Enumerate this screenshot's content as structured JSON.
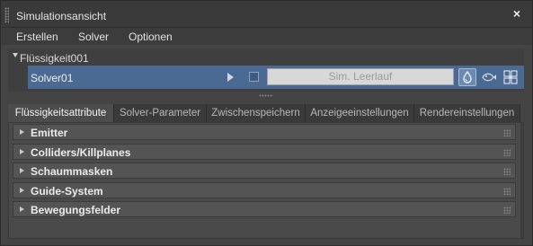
{
  "window": {
    "title": "Simulationsansicht",
    "close_icon": "×"
  },
  "menu": {
    "items": [
      "Erstellen",
      "Solver",
      "Optionen"
    ]
  },
  "tree": {
    "parent_label": "Flüssigkeit001",
    "child_label": "Solver01",
    "sim_status": "Sim. Leerlauf",
    "icons": [
      "play-icon",
      "stop-icon",
      "fluid-drop-icon",
      "fish-icon",
      "grid-icon"
    ]
  },
  "tabs": [
    {
      "label": "Flüssigkeitsattribute",
      "active": true
    },
    {
      "label": "Solver-Parameter",
      "active": false
    },
    {
      "label": "Zwischenspeichern",
      "active": false
    },
    {
      "label": "Anzeigeeinstellungen",
      "active": false
    },
    {
      "label": "Rendereinstellungen",
      "active": false
    }
  ],
  "rollouts": [
    "Emitter",
    "Colliders/Killplanes",
    "Schaummasken",
    "Guide-System",
    "Bewegungsfelder"
  ],
  "colors": {
    "selection": "#4a6a94",
    "background": "#444444",
    "active_icon": "#6b8ab2"
  }
}
